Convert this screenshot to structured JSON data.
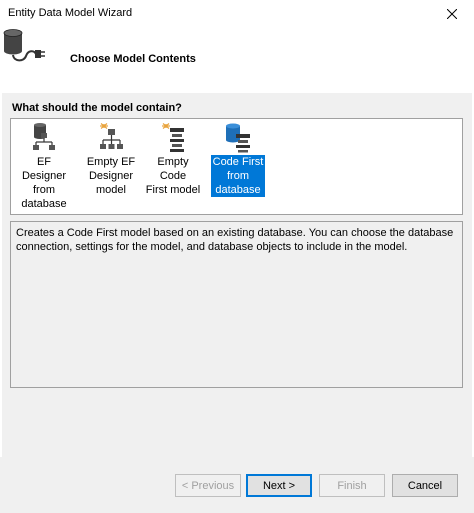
{
  "window": {
    "title": "Entity Data Model Wizard"
  },
  "header": {
    "title": "Choose Model Contents",
    "icon": "database-plug-icon"
  },
  "content": {
    "question": "What should the model contain?",
    "options": [
      {
        "label": "EF Designer\nfrom\ndatabase",
        "icon": "ef-designer-from-database-icon",
        "selected": false
      },
      {
        "label": "Empty EF\nDesigner\nmodel",
        "icon": "empty-ef-designer-icon",
        "selected": false
      },
      {
        "label": "Empty Code\nFirst model",
        "icon": "empty-code-first-icon",
        "selected": false
      },
      {
        "label": "Code First\nfrom\ndatabase",
        "icon": "code-first-from-database-icon",
        "selected": true
      }
    ],
    "description": "Creates a Code First model based on an existing database. You can choose the database connection, settings for the model, and database objects to include in the model."
  },
  "footer": {
    "previous_label": "< Previous",
    "next_label": "Next >",
    "finish_label": "Finish",
    "cancel_label": "Cancel"
  },
  "colors": {
    "selection": "#0078d7",
    "content_bg": "#f0f0f0",
    "border": "#a0a0a0"
  }
}
